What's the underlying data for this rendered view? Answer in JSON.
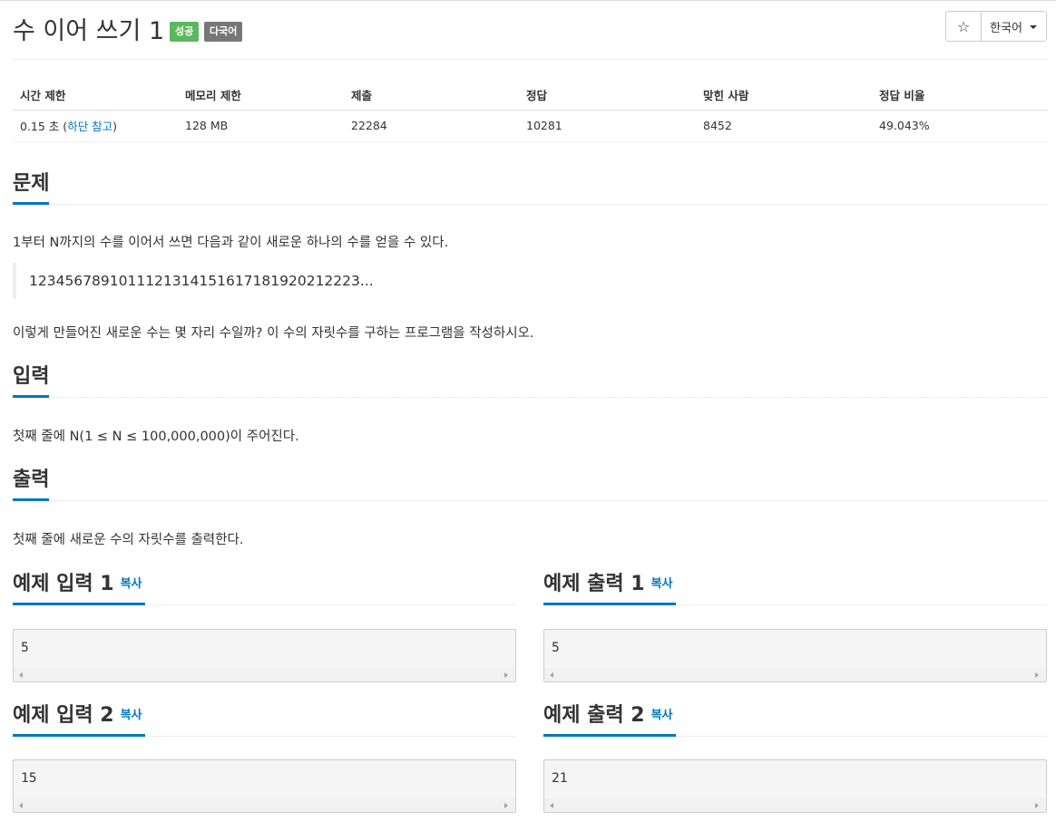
{
  "problem": {
    "title": "수 이어 쓰기 1",
    "badges": [
      "성공",
      "다국어"
    ],
    "star_icon": "star-outline-icon",
    "language": "한국어"
  },
  "stats": {
    "headers": [
      "시간 제한",
      "메모리 제한",
      "제출",
      "정답",
      "맞힌 사람",
      "정답 비율"
    ],
    "time_limit": "0.15 초",
    "time_note_open": "(",
    "time_note_link": "하단 참고",
    "time_note_close": ")",
    "memory_limit": "128 MB",
    "submissions": "22284",
    "accepted": "10281",
    "solvers": "8452",
    "ratio": "49.043%"
  },
  "sections": {
    "problem_title": "문제",
    "problem_text_1": "1부터 N까지의 수를 이어서 쓰면 다음과 같이 새로운 하나의 수를 얻을 수 있다.",
    "problem_quote": "1234567891011121314151617181920212223...",
    "problem_text_2": "이렇게 만들어진 새로운 수는 몇 자리 수일까? 이 수의 자릿수를 구하는 프로그램을 작성하시오.",
    "input_title": "입력",
    "input_text": "첫째 줄에 N(1 ≤ N ≤ 100,000,000)이 주어진다.",
    "output_title": "출력",
    "output_text": "첫째 줄에 새로운 수의 자릿수를 출력한다."
  },
  "samples": [
    {
      "title": "예제 입력 1",
      "copy": "복사",
      "value": "5"
    },
    {
      "title": "예제 출력 1",
      "copy": "복사",
      "value": "5"
    },
    {
      "title": "예제 입력 2",
      "copy": "복사",
      "value": "15"
    },
    {
      "title": "예제 출력 2",
      "copy": "복사",
      "value": "21"
    }
  ]
}
